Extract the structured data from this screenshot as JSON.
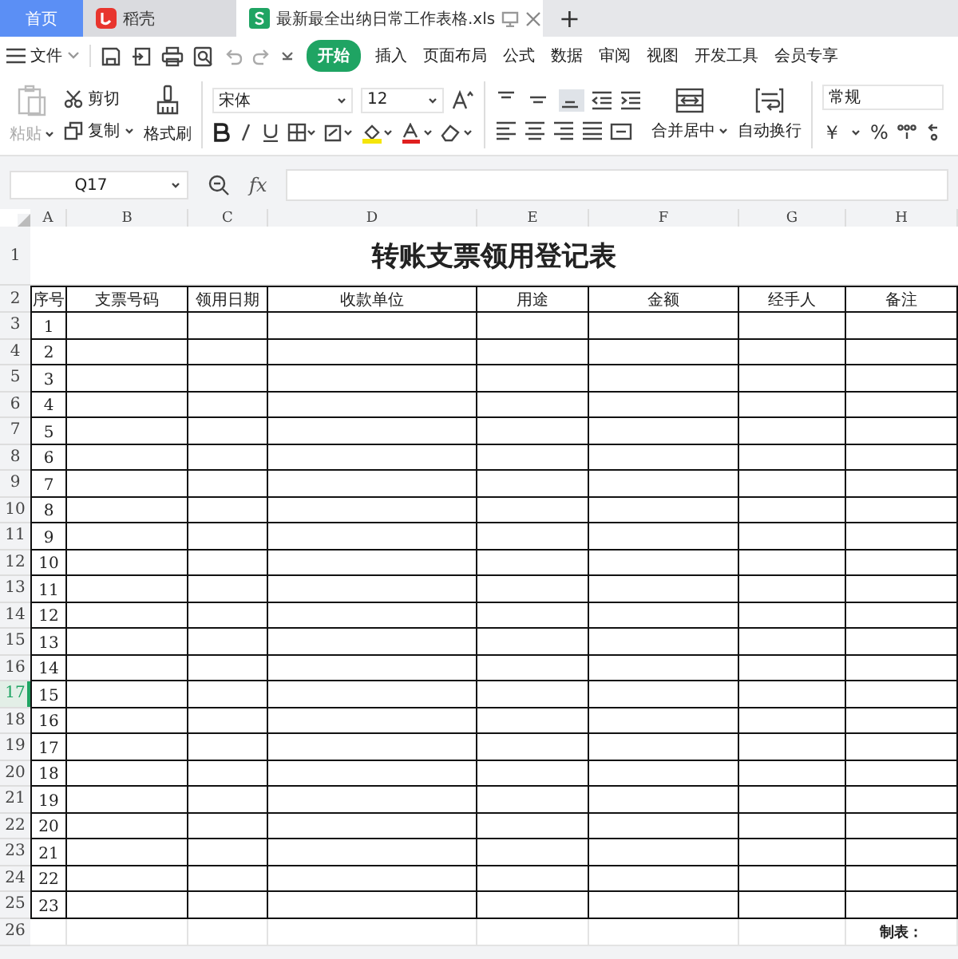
{
  "tabs": [
    {
      "label": "首页",
      "kind": "home",
      "selected": false
    },
    {
      "label": "稻壳",
      "kind": "docer",
      "selected": false
    },
    {
      "label": "最新最全出纳日常工作表格.xls",
      "kind": "sheet",
      "selected": true
    }
  ],
  "new_tab": "+",
  "menu": {
    "file": "文件",
    "items": [
      {
        "label": "开始",
        "selected": true
      },
      {
        "label": "插入",
        "selected": false
      },
      {
        "label": "页面布局",
        "selected": false
      },
      {
        "label": "公式",
        "selected": false
      },
      {
        "label": "数据",
        "selected": false
      },
      {
        "label": "审阅",
        "selected": false
      },
      {
        "label": "视图",
        "selected": false
      },
      {
        "label": "开发工具",
        "selected": false
      },
      {
        "label": "会员专享",
        "selected": false
      }
    ]
  },
  "ribbon": {
    "paste": "粘贴",
    "cut": "剪切",
    "copy": "复制",
    "format_painter": "格式刷",
    "font": "宋体",
    "font_size": "12",
    "vertical_align": [
      {
        "selected": false
      },
      {
        "selected": false
      },
      {
        "selected": true
      }
    ],
    "merge": "合并居中",
    "wrap": "自动换行",
    "number_format": "常规",
    "currency": "￥",
    "percent": "%"
  },
  "formula_bar": {
    "name_box": "Q17",
    "fx": "fx"
  },
  "sheet": {
    "columns": [
      "A",
      "B",
      "C",
      "D",
      "E",
      "F",
      "G",
      "H"
    ],
    "row_headers": [
      {
        "label": "1",
        "selected": false
      },
      {
        "label": "2",
        "selected": false
      },
      {
        "label": "3",
        "selected": false
      },
      {
        "label": "4",
        "selected": false
      },
      {
        "label": "5",
        "selected": false
      },
      {
        "label": "6",
        "selected": false
      },
      {
        "label": "7",
        "selected": false
      },
      {
        "label": "8",
        "selected": false
      },
      {
        "label": "9",
        "selected": false
      },
      {
        "label": "10",
        "selected": false
      },
      {
        "label": "11",
        "selected": false
      },
      {
        "label": "12",
        "selected": false
      },
      {
        "label": "13",
        "selected": false
      },
      {
        "label": "14",
        "selected": false
      },
      {
        "label": "15",
        "selected": false
      },
      {
        "label": "16",
        "selected": false
      },
      {
        "label": "17",
        "selected": true
      },
      {
        "label": "18",
        "selected": false
      },
      {
        "label": "19",
        "selected": false
      },
      {
        "label": "20",
        "selected": false
      },
      {
        "label": "21",
        "selected": false
      },
      {
        "label": "22",
        "selected": false
      },
      {
        "label": "23",
        "selected": false
      },
      {
        "label": "24",
        "selected": false
      },
      {
        "label": "25",
        "selected": false
      },
      {
        "label": "26",
        "selected": false
      }
    ],
    "title": "转账支票领用登记表",
    "headers": [
      "序号",
      "支票号码",
      "领用日期",
      "收款单位",
      "用途",
      "金额",
      "经手人",
      "备注"
    ],
    "records": [
      "1",
      "2",
      "3",
      "4",
      "5",
      "6",
      "7",
      "8",
      "9",
      "10",
      "11",
      "12",
      "13",
      "14",
      "15",
      "16",
      "17",
      "18",
      "19",
      "20",
      "21",
      "22",
      "23"
    ],
    "footer": "制表："
  }
}
